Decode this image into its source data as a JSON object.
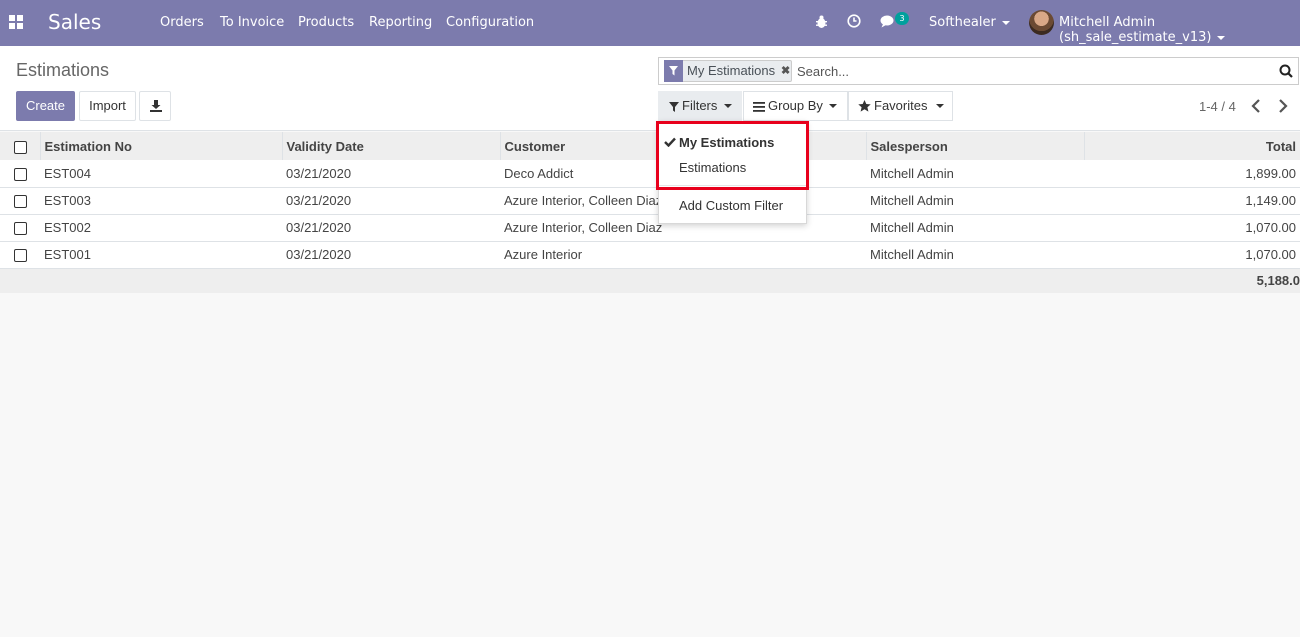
{
  "navbar": {
    "app_name": "Sales",
    "menus": [
      "Orders",
      "To Invoice",
      "Products",
      "Reporting",
      "Configuration"
    ],
    "chat_badge": "3",
    "company": "Softhealer",
    "user": "Mitchell Admin (sh_sale_estimate_v13)",
    "icons": [
      "apps-grid-icon",
      "bug-icon",
      "clock-icon",
      "chat-icon",
      "avatar"
    ]
  },
  "control": {
    "title": "Estimations",
    "create_label": "Create",
    "import_label": "Import",
    "search": {
      "facet_label": "My Estimations",
      "placeholder": "Search..."
    },
    "filters_label": "Filters",
    "groupby_label": "Group By",
    "favorites_label": "Favorites",
    "pager": "1-4 / 4"
  },
  "filters_menu": {
    "items": [
      {
        "label": "My Estimations",
        "selected": true
      },
      {
        "label": "Estimations",
        "selected": false
      }
    ],
    "custom_label": "Add Custom Filter"
  },
  "table": {
    "columns": [
      "Estimation No",
      "Validity Date",
      "Customer",
      "Salesperson",
      "Total"
    ],
    "rows": [
      {
        "no": "EST004",
        "date": "03/21/2020",
        "customer": "Deco Addict",
        "salesperson": "Mitchell Admin",
        "total": "1,899.00"
      },
      {
        "no": "EST003",
        "date": "03/21/2020",
        "customer": "Azure Interior, Colleen Diaz",
        "salesperson": "Mitchell Admin",
        "total": "1,149.00"
      },
      {
        "no": "EST002",
        "date": "03/21/2020",
        "customer": "Azure Interior, Colleen Diaz",
        "salesperson": "Mitchell Admin",
        "total": "1,070.00"
      },
      {
        "no": "EST001",
        "date": "03/21/2020",
        "customer": "Azure Interior",
        "salesperson": "Mitchell Admin",
        "total": "1,070.00"
      }
    ],
    "footer_total": "5,188.0"
  },
  "colors": {
    "brand": "#7c7bad",
    "badge": "#00a09d",
    "highlight": "#e8001c"
  }
}
